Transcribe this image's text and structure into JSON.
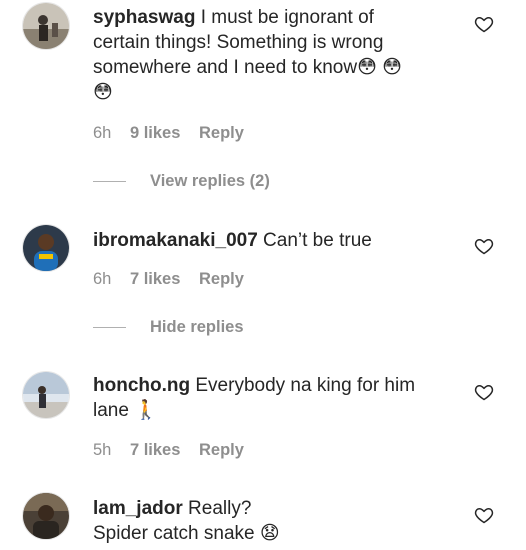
{
  "comments": [
    {
      "username": "syphaswag",
      "text": "I must be ignorant of certain things! Something is wrong somewhere and I need to know",
      "emoji": "😳 😳 😳",
      "time": "6h",
      "likes": "9 likes",
      "reply": "Reply",
      "replies_toggle": "View replies (2)"
    },
    {
      "username": "ibromakanaki_007",
      "text": "Can’t be true",
      "time": "6h",
      "likes": "7 likes",
      "reply": "Reply",
      "replies_toggle": "Hide replies"
    },
    {
      "username": "honcho.ng",
      "text": "Everybody na king for him lane",
      "emoji": "🚶",
      "time": "5h",
      "likes": "7 likes",
      "reply": "Reply"
    },
    {
      "username": "lam_jador",
      "text": "Really?",
      "text2": "Spider catch snake",
      "emoji": "😧"
    }
  ],
  "icons": {
    "heart": "heart-outline-icon"
  }
}
